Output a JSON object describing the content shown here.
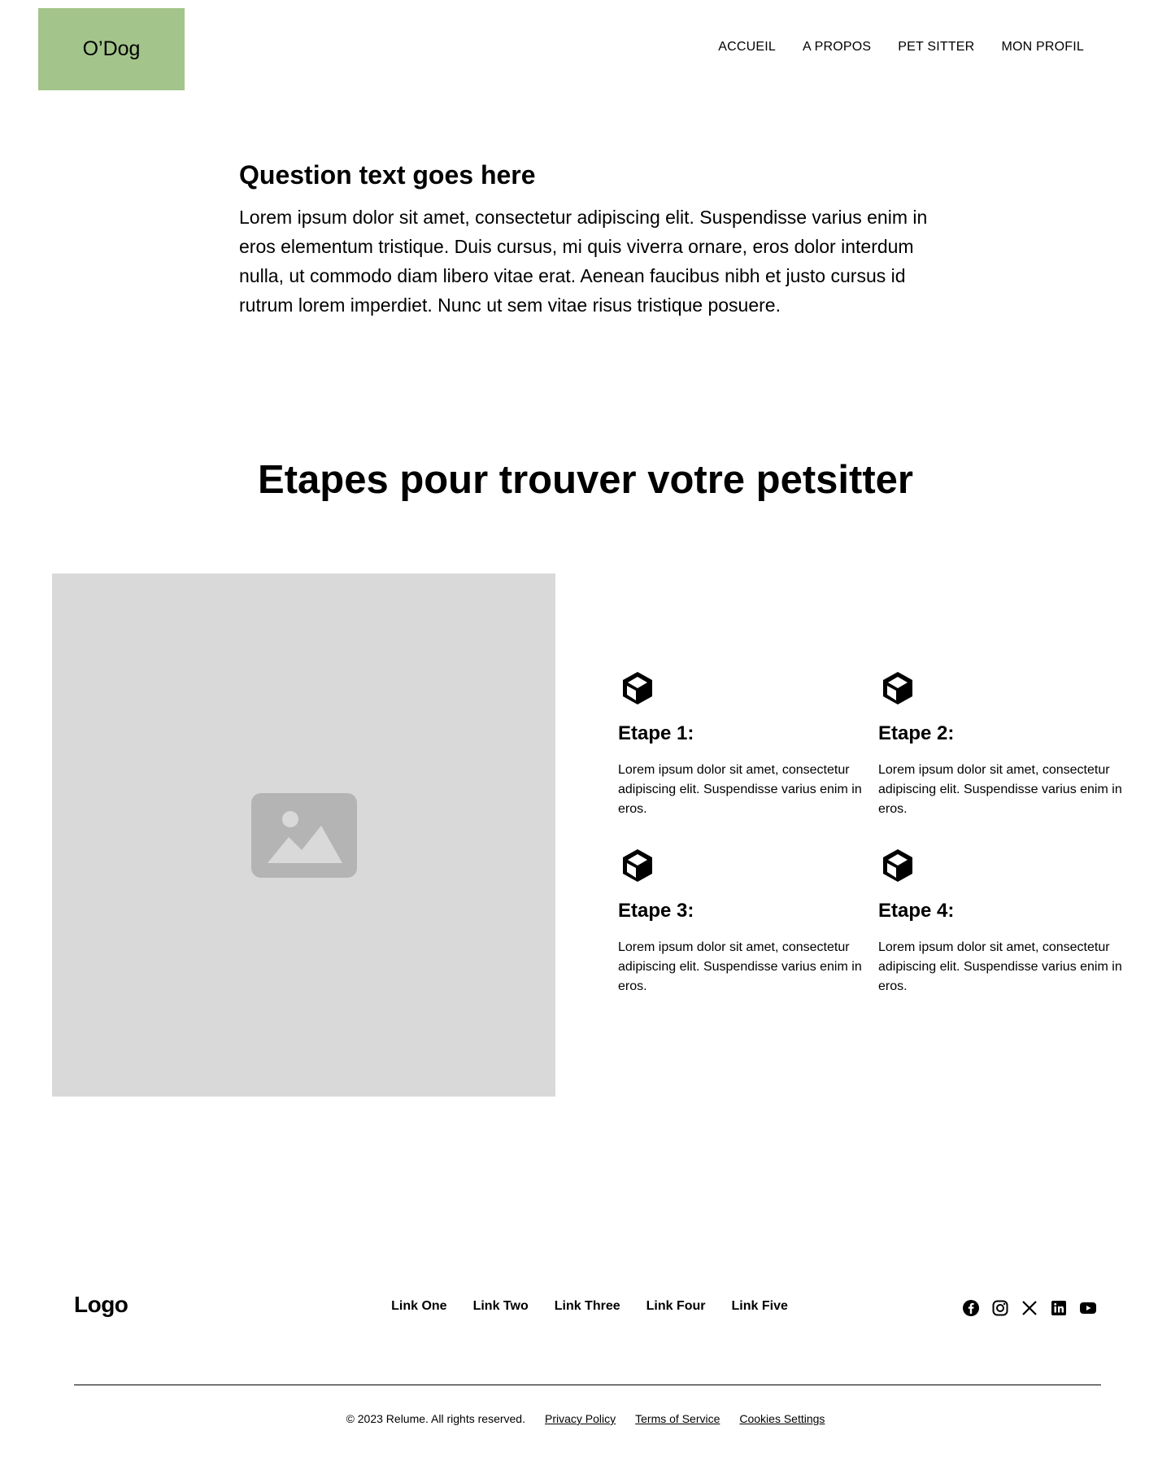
{
  "header": {
    "brand": "O’Dog",
    "brand_color": "#a3c48a",
    "nav": [
      "ACCUEIL",
      "A PROPOS",
      "PET SITTER",
      "MON PROFIL"
    ]
  },
  "faq": {
    "question": "Question text goes here",
    "answer": "Lorem ipsum dolor sit amet, consectetur adipiscing elit. Suspendisse varius enim in eros elementum tristique. Duis cursus, mi quis viverra ornare, eros dolor interdum nulla, ut commodo diam libero vitae erat. Aenean faucibus nibh et justo cursus id rutrum lorem imperdiet. Nunc ut sem vitae risus tristique posuere."
  },
  "steps": {
    "title": "Etapes pour trouver votre petsitter",
    "image_icon": "image-placeholder-icon",
    "items": [
      {
        "icon": "cube-icon",
        "title": "Etape 1:",
        "text": "Lorem ipsum dolor sit amet, consectetur adipiscing elit. Suspendisse varius enim in eros."
      },
      {
        "icon": "cube-icon",
        "title": "Etape 2:",
        "text": "Lorem ipsum dolor sit amet, consectetur adipiscing elit. Suspendisse varius enim in eros."
      },
      {
        "icon": "cube-icon",
        "title": "Etape 3:",
        "text": "Lorem ipsum dolor sit amet, consectetur adipiscing elit. Suspendisse varius enim in eros."
      },
      {
        "icon": "cube-icon",
        "title": "Etape 4:",
        "text": "Lorem ipsum dolor sit amet, consectetur adipiscing elit. Suspendisse varius enim in eros."
      }
    ]
  },
  "footer": {
    "logo": "Logo",
    "links": [
      "Link One",
      "Link Two",
      "Link Three",
      "Link Four",
      "Link Five"
    ],
    "socials": [
      "facebook-icon",
      "instagram-icon",
      "x-icon",
      "linkedin-icon",
      "youtube-icon"
    ],
    "copyright": "© 2023 Relume. All rights reserved.",
    "legal_links": [
      "Privacy Policy",
      "Terms of Service",
      "Cookies Settings"
    ]
  }
}
